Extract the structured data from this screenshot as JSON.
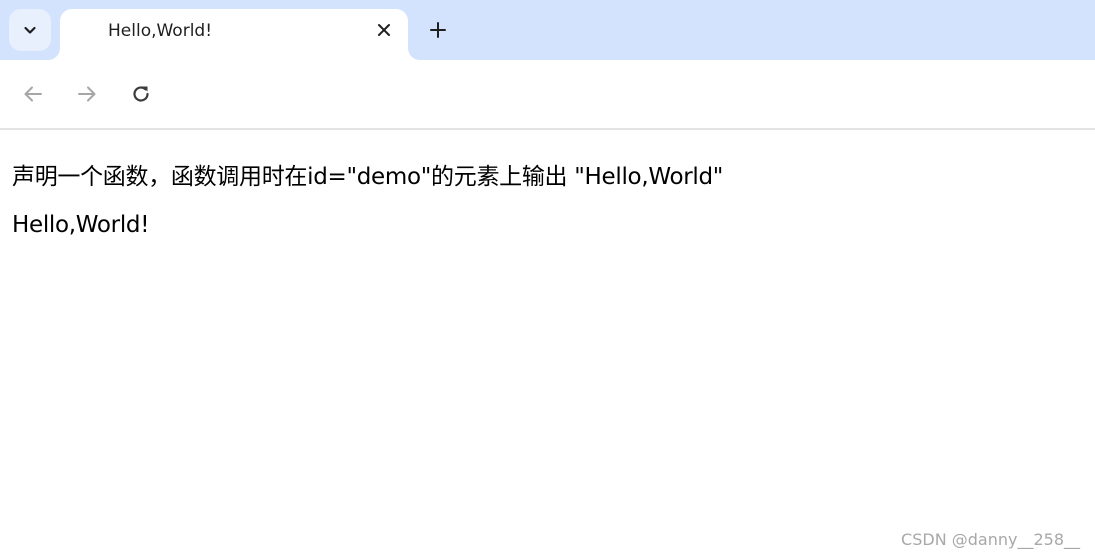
{
  "browser": {
    "tab": {
      "title": "Hello,World!"
    },
    "icons": {
      "tab_search": "chevron-down-icon",
      "tab_close": "close-icon",
      "new_tab": "plus-icon",
      "back": "arrow-left-icon",
      "forward": "arrow-right-icon",
      "reload": "reload-icon"
    },
    "colors": {
      "tabstrip_bg": "#d3e3fd",
      "active_tab_bg": "#ffffff"
    }
  },
  "page": {
    "description": "声明一个函数，函数调用时在id=\"demo\"的元素上输出 \"Hello,World\"",
    "demo_output": "Hello,World!"
  },
  "watermark": "CSDN @danny__258__"
}
